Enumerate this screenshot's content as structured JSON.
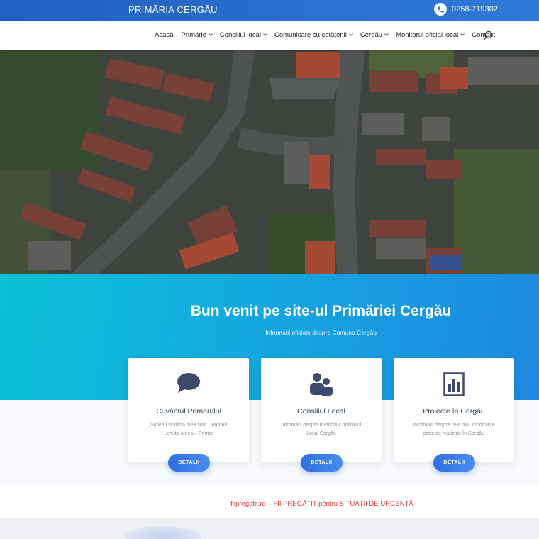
{
  "header": {
    "site_title": "PRIMĂRIA CERGĂU",
    "phone": "0258-719302"
  },
  "nav": {
    "items": [
      {
        "label": "Acasă",
        "dropdown": false
      },
      {
        "label": "Primărie",
        "dropdown": true
      },
      {
        "label": "Consiliul local",
        "dropdown": true
      },
      {
        "label": "Comunicare cu cetățenii",
        "dropdown": true
      },
      {
        "label": "Cergău",
        "dropdown": true
      },
      {
        "label": "Monitorul oficial local",
        "dropdown": true
      },
      {
        "label": "Contact",
        "dropdown": false
      }
    ]
  },
  "hero": {
    "image": "aerial-village-photo"
  },
  "welcome": {
    "title": "Bun venit pe site-ul Primăriei Cergău",
    "subtitle": "Informații oficiale despre Comuna Cergău"
  },
  "cards": [
    {
      "icon": "speech-bubble-icon",
      "title": "Cuvântul Primarului",
      "text_line1": "„Sufletul și inima mea sunt Cergăul!”",
      "text_line2": "Lenuța Aldea – Primar",
      "button": "DETALII"
    },
    {
      "icon": "users-icon",
      "title": "Consiliul Local",
      "text_line1": "Informații despre membrii Consiliului",
      "text_line2": "Local Cergău",
      "button": "DETALII"
    },
    {
      "icon": "bar-chart-icon",
      "title": "Proiecte în Cergău",
      "text_line1": "Informații despre cele mai importante",
      "text_line2": "proiecte realizate în Cergău",
      "button": "DETALII"
    }
  ],
  "emergency": {
    "text": "fiipregatit.ro – FII PREGĂTIT pentru SITUAȚII DE URGENȚĂ"
  },
  "colors": {
    "topbar": "#2a6fd0",
    "band_start": "#0bc2d6",
    "band_end": "#1e88e0",
    "button": "#3b7de8",
    "alert": "#e53935",
    "icon": "#3d4a6b"
  }
}
